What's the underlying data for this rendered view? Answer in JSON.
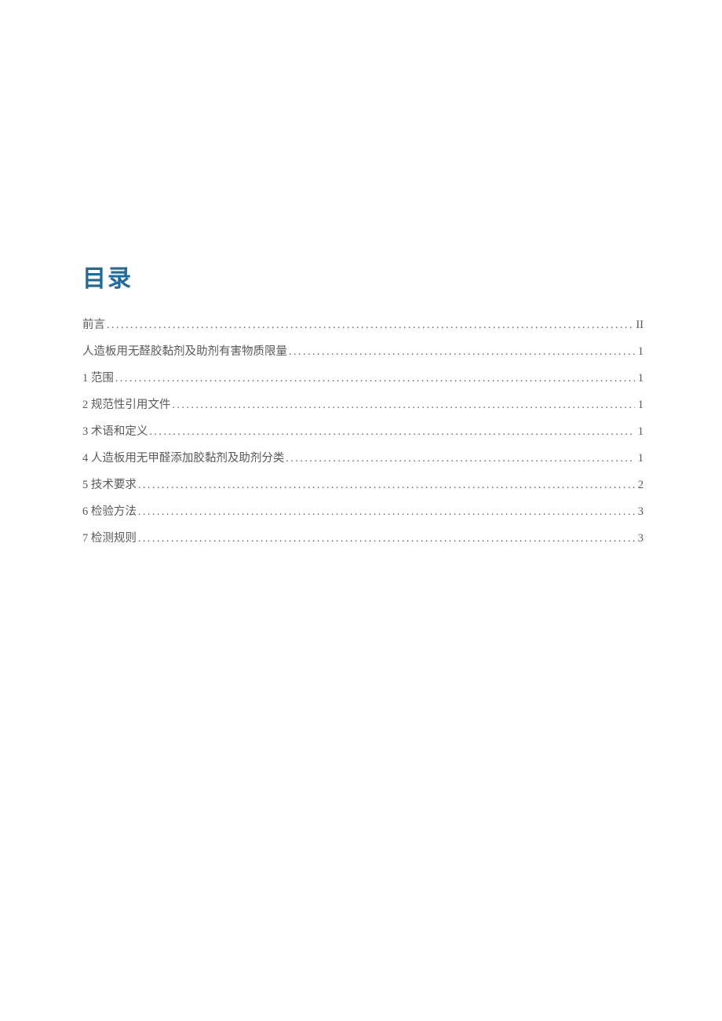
{
  "toc": {
    "title": "目录",
    "entries": [
      {
        "label": "前言",
        "page": "II"
      },
      {
        "label": "人造板用无醛胶黏剂及助剂有害物质限量",
        "page": "1"
      },
      {
        "label": "1 范围",
        "page": "1"
      },
      {
        "label": "2 规范性引用文件",
        "page": "1"
      },
      {
        "label": "3 术语和定义",
        "page": "1"
      },
      {
        "label": "4 人造板用无甲醛添加胶黏剂及助剂分类",
        "page": "1"
      },
      {
        "label": "5 技术要求",
        "page": "2"
      },
      {
        "label": "6 检验方法",
        "page": "3"
      },
      {
        "label": "7 检测规则",
        "page": "3"
      }
    ]
  }
}
